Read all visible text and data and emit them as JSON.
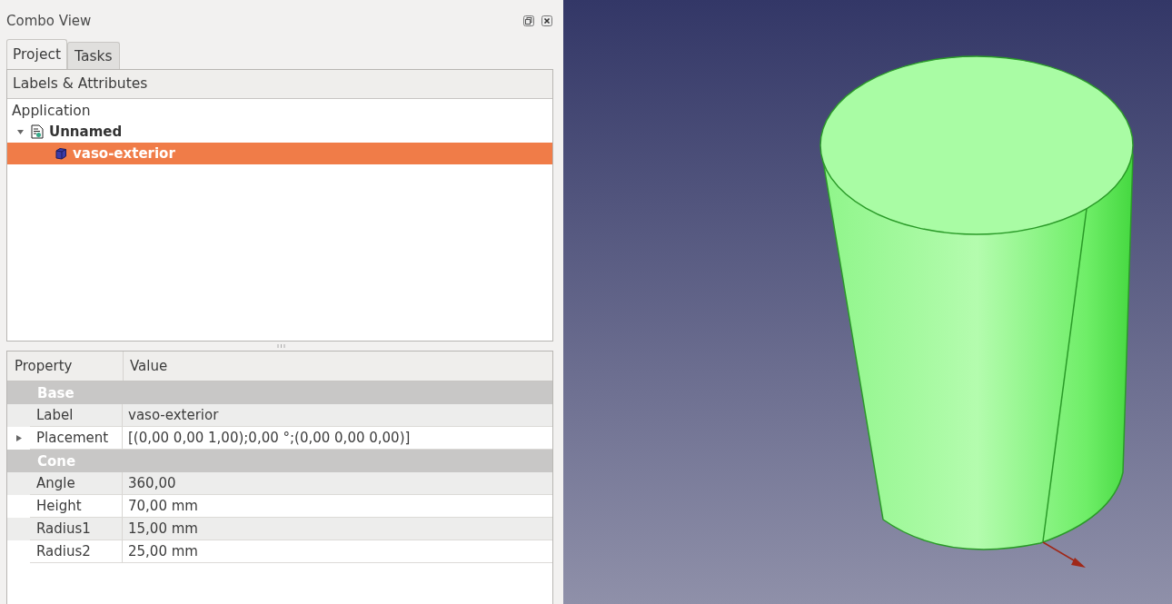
{
  "panel": {
    "title": "Combo View"
  },
  "tabs": [
    {
      "label": "Project",
      "selected": true
    },
    {
      "label": "Tasks",
      "selected": false
    }
  ],
  "tree": {
    "header": "Labels & Attributes",
    "root": "Application",
    "items": [
      {
        "label": "Unnamed",
        "kind": "document",
        "selected": false,
        "expanded": true,
        "children": [
          {
            "label": "vaso-exterior",
            "kind": "solid",
            "selected": true
          }
        ]
      }
    ]
  },
  "properties": {
    "columns": [
      "Property",
      "Value"
    ],
    "rows": [
      {
        "kind": "group",
        "name": "Base"
      },
      {
        "kind": "property",
        "name": "Label",
        "value": "vaso-exterior"
      },
      {
        "kind": "property",
        "name": "Placement",
        "value": "[(0,00 0,00 1,00);0,00 °;(0,00 0,00 0,00)]",
        "expanded": false
      },
      {
        "kind": "group",
        "name": "Cone"
      },
      {
        "kind": "property",
        "name": "Angle",
        "value": "360,00"
      },
      {
        "kind": "property",
        "name": "Height",
        "value": "70,00 mm"
      },
      {
        "kind": "property",
        "name": "Radius1",
        "value": "15,00 mm"
      },
      {
        "kind": "property",
        "name": "Radius2",
        "value": "25,00 mm"
      }
    ]
  }
}
